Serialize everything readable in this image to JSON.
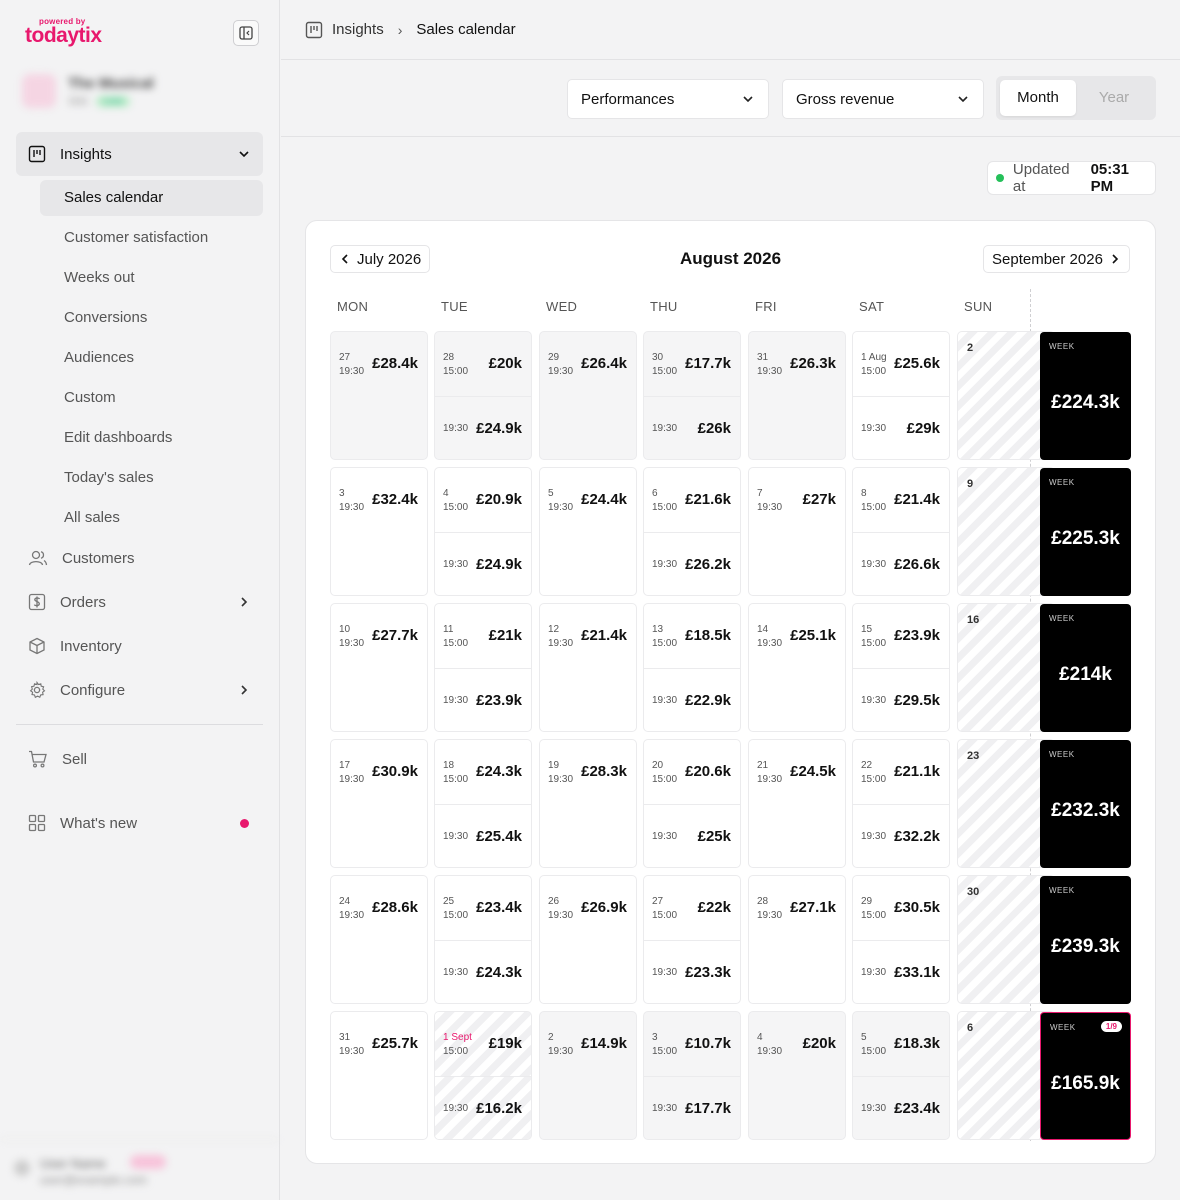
{
  "brand": {
    "powered": "powered by",
    "name": "todaytix",
    "color": "#e8186d"
  },
  "account": {
    "name": "The Musical",
    "code": "1111",
    "tag": "Live"
  },
  "sidebar": {
    "group": {
      "label": "Insights"
    },
    "subitems": [
      "Sales calendar",
      "Customer satisfaction",
      "Weeks out",
      "Conversions",
      "Audiences",
      "Custom",
      "Edit dashboards",
      "Today's sales",
      "All sales"
    ],
    "items": [
      {
        "label": "Customers",
        "icon": "users-icon"
      },
      {
        "label": "Orders",
        "icon": "dollar-icon"
      },
      {
        "label": "Inventory",
        "icon": "box-icon"
      },
      {
        "label": "Configure",
        "icon": "gear-icon"
      },
      {
        "label": "Sell",
        "icon": "cart-icon"
      },
      {
        "label": "What's new",
        "icon": "grid-icon"
      }
    ]
  },
  "footer_user": {
    "name": "User Name",
    "email": "user@example.com"
  },
  "breadcrumb": {
    "root": "Insights",
    "current": "Sales calendar"
  },
  "filters": {
    "performances": "Performances",
    "metric": "Gross revenue",
    "period_options": [
      "Month",
      "Year"
    ],
    "period_selected": "Month"
  },
  "updated": {
    "prefix": "Updated at",
    "time": "05:31 PM"
  },
  "calendar": {
    "prev": "July 2026",
    "title": "August 2026",
    "next": "September 2026",
    "days": [
      "MON",
      "TUE",
      "WED",
      "THU",
      "FRI",
      "SAT",
      "SUN"
    ],
    "week_label": "WEEK",
    "weeks": [
      {
        "cells": [
          {
            "date": "27",
            "gray": true,
            "slots": [
              {
                "time": "19:30",
                "value": "£28.4k"
              }
            ]
          },
          {
            "date": "28",
            "gray": true,
            "slots": [
              {
                "time": "15:00",
                "value": "£20k"
              },
              {
                "time": "19:30",
                "value": "£24.9k"
              }
            ]
          },
          {
            "date": "29",
            "gray": true,
            "slots": [
              {
                "time": "19:30",
                "value": "£26.4k"
              }
            ]
          },
          {
            "date": "30",
            "gray": true,
            "slots": [
              {
                "time": "15:00",
                "value": "£17.7k"
              },
              {
                "time": "19:30",
                "value": "£26k"
              }
            ]
          },
          {
            "date": "31",
            "gray": true,
            "slots": [
              {
                "time": "19:30",
                "value": "£26.3k"
              }
            ]
          },
          {
            "date": "1 Aug",
            "slots": [
              {
                "time": "15:00",
                "value": "£25.6k"
              },
              {
                "time": "19:30",
                "value": "£29k"
              }
            ]
          },
          {
            "date": "2",
            "sunday": true
          }
        ],
        "total": "£224.3k"
      },
      {
        "cells": [
          {
            "date": "3",
            "slots": [
              {
                "time": "19:30",
                "value": "£32.4k"
              }
            ]
          },
          {
            "date": "4",
            "slots": [
              {
                "time": "15:00",
                "value": "£20.9k"
              },
              {
                "time": "19:30",
                "value": "£24.9k"
              }
            ]
          },
          {
            "date": "5",
            "slots": [
              {
                "time": "19:30",
                "value": "£24.4k"
              }
            ]
          },
          {
            "date": "6",
            "slots": [
              {
                "time": "15:00",
                "value": "£21.6k"
              },
              {
                "time": "19:30",
                "value": "£26.2k"
              }
            ]
          },
          {
            "date": "7",
            "slots": [
              {
                "time": "19:30",
                "value": "£27k"
              }
            ]
          },
          {
            "date": "8",
            "slots": [
              {
                "time": "15:00",
                "value": "£21.4k"
              },
              {
                "time": "19:30",
                "value": "£26.6k"
              }
            ]
          },
          {
            "date": "9",
            "sunday": true
          }
        ],
        "total": "£225.3k"
      },
      {
        "cells": [
          {
            "date": "10",
            "slots": [
              {
                "time": "19:30",
                "value": "£27.7k"
              }
            ]
          },
          {
            "date": "11",
            "slots": [
              {
                "time": "15:00",
                "value": "£21k"
              },
              {
                "time": "19:30",
                "value": "£23.9k"
              }
            ]
          },
          {
            "date": "12",
            "slots": [
              {
                "time": "19:30",
                "value": "£21.4k"
              }
            ]
          },
          {
            "date": "13",
            "slots": [
              {
                "time": "15:00",
                "value": "£18.5k"
              },
              {
                "time": "19:30",
                "value": "£22.9k"
              }
            ]
          },
          {
            "date": "14",
            "slots": [
              {
                "time": "19:30",
                "value": "£25.1k"
              }
            ]
          },
          {
            "date": "15",
            "slots": [
              {
                "time": "15:00",
                "value": "£23.9k"
              },
              {
                "time": "19:30",
                "value": "£29.5k"
              }
            ]
          },
          {
            "date": "16",
            "sunday": true
          }
        ],
        "total": "£214k"
      },
      {
        "cells": [
          {
            "date": "17",
            "slots": [
              {
                "time": "19:30",
                "value": "£30.9k"
              }
            ]
          },
          {
            "date": "18",
            "slots": [
              {
                "time": "15:00",
                "value": "£24.3k"
              },
              {
                "time": "19:30",
                "value": "£25.4k"
              }
            ]
          },
          {
            "date": "19",
            "slots": [
              {
                "time": "19:30",
                "value": "£28.3k"
              }
            ]
          },
          {
            "date": "20",
            "slots": [
              {
                "time": "15:00",
                "value": "£20.6k"
              },
              {
                "time": "19:30",
                "value": "£25k"
              }
            ]
          },
          {
            "date": "21",
            "slots": [
              {
                "time": "19:30",
                "value": "£24.5k"
              }
            ]
          },
          {
            "date": "22",
            "slots": [
              {
                "time": "15:00",
                "value": "£21.1k"
              },
              {
                "time": "19:30",
                "value": "£32.2k"
              }
            ]
          },
          {
            "date": "23",
            "sunday": true
          }
        ],
        "total": "£232.3k"
      },
      {
        "cells": [
          {
            "date": "24",
            "slots": [
              {
                "time": "19:30",
                "value": "£28.6k"
              }
            ]
          },
          {
            "date": "25",
            "slots": [
              {
                "time": "15:00",
                "value": "£23.4k"
              },
              {
                "time": "19:30",
                "value": "£24.3k"
              }
            ]
          },
          {
            "date": "26",
            "slots": [
              {
                "time": "19:30",
                "value": "£26.9k"
              }
            ]
          },
          {
            "date": "27",
            "slots": [
              {
                "time": "15:00",
                "value": "£22k"
              },
              {
                "time": "19:30",
                "value": "£23.3k"
              }
            ]
          },
          {
            "date": "28",
            "slots": [
              {
                "time": "19:30",
                "value": "£27.1k"
              }
            ]
          },
          {
            "date": "29",
            "slots": [
              {
                "time": "15:00",
                "value": "£30.5k"
              },
              {
                "time": "19:30",
                "value": "£33.1k"
              }
            ]
          },
          {
            "date": "30",
            "sunday": true
          }
        ],
        "total": "£239.3k"
      },
      {
        "cells": [
          {
            "date": "31",
            "slots": [
              {
                "time": "19:30",
                "value": "£25.7k"
              }
            ]
          },
          {
            "date": "1 Sept",
            "red": true,
            "striped": true,
            "slots": [
              {
                "time": "15:00",
                "value": "£19k"
              },
              {
                "time": "19:30",
                "value": "£16.2k"
              }
            ]
          },
          {
            "date": "2",
            "gray": true,
            "slots": [
              {
                "time": "19:30",
                "value": "£14.9k"
              }
            ]
          },
          {
            "date": "3",
            "gray": true,
            "slots": [
              {
                "time": "15:00",
                "value": "£10.7k"
              },
              {
                "time": "19:30",
                "value": "£17.7k"
              }
            ]
          },
          {
            "date": "4",
            "gray": true,
            "slots": [
              {
                "time": "19:30",
                "value": "£20k"
              }
            ]
          },
          {
            "date": "5",
            "gray": true,
            "slots": [
              {
                "time": "15:00",
                "value": "£18.3k"
              },
              {
                "time": "19:30",
                "value": "£23.4k"
              }
            ]
          },
          {
            "date": "6",
            "sunday": true
          }
        ],
        "total": "£165.9k",
        "badge": "1/9",
        "highlight": true
      }
    ]
  }
}
